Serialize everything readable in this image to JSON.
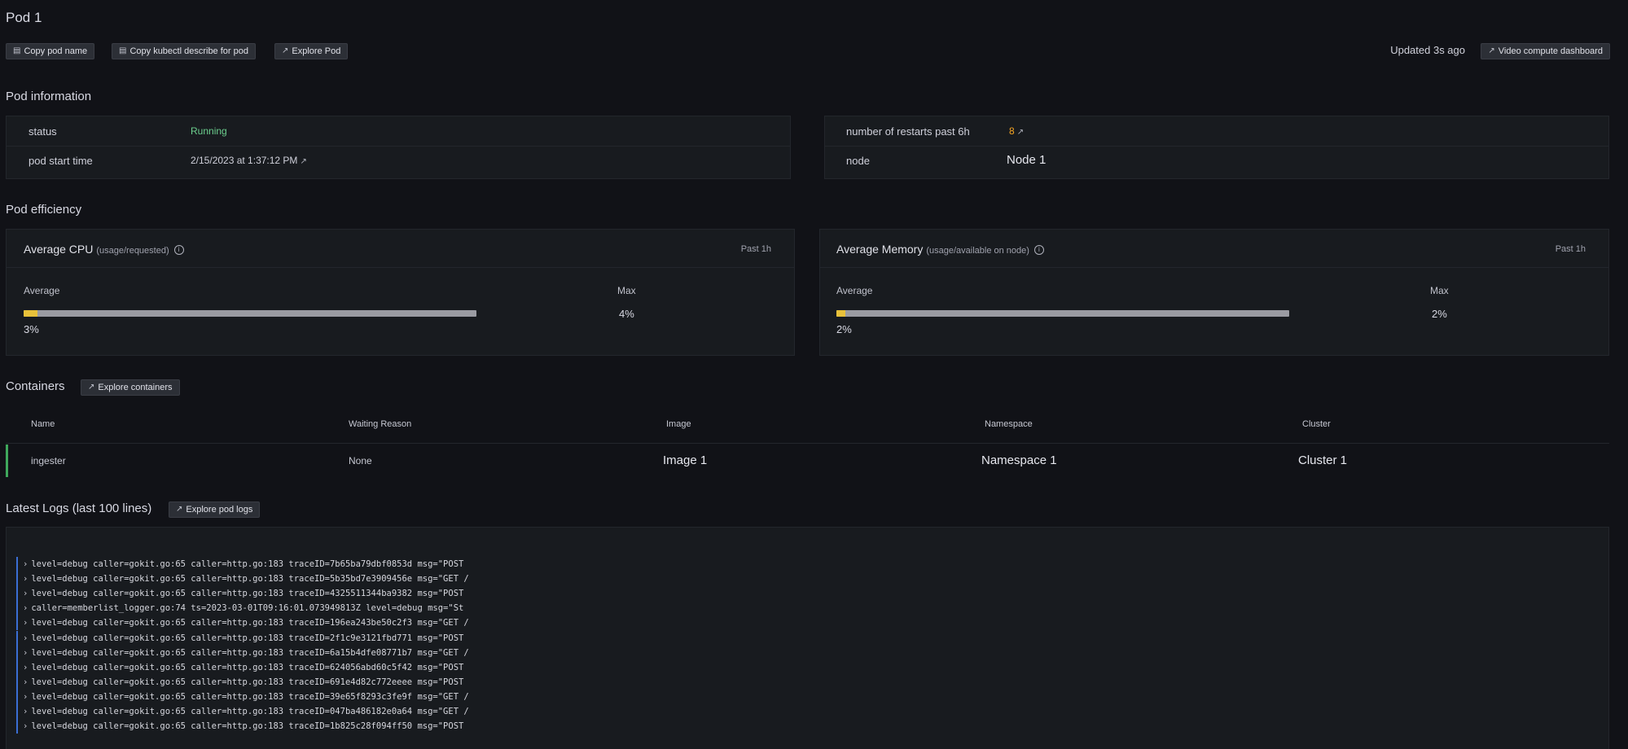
{
  "page": {
    "title": "Pod 1",
    "updated": "Updated 3s ago"
  },
  "toolbar": {
    "copy_pod_name": "Copy pod name",
    "copy_describe": "Copy kubectl describe for pod",
    "explore_pod": "Explore Pod",
    "video_dashboard": "Video compute dashboard"
  },
  "pod_info": {
    "heading": "Pod information",
    "status_label": "status",
    "status_value": "Running",
    "start_label": "pod start time",
    "start_value": "2/15/2023 at 1:37:12 PM",
    "restarts_label": "number of restarts past 6h",
    "restarts_value": "8",
    "node_label": "node",
    "node_value": "Node 1",
    "status_color": "#6ccf8e",
    "restarts_color": "#f5a623"
  },
  "efficiency": {
    "heading": "Pod efficiency",
    "cpu": {
      "title": "Average CPU",
      "subtitle": "(usage/requested)",
      "range": "Past 1h",
      "avg_label": "Average",
      "avg_value": "3%",
      "avg_fraction": 0.03,
      "max_label": "Max",
      "max_value": "4%"
    },
    "memory": {
      "title": "Average Memory",
      "subtitle": "(usage/available on node)",
      "range": "Past 1h",
      "avg_label": "Average",
      "avg_value": "2%",
      "avg_fraction": 0.02,
      "max_label": "Max",
      "max_value": "2%"
    }
  },
  "containers": {
    "heading": "Containers",
    "explore_label": "Explore containers",
    "columns": [
      "Name",
      "Waiting Reason",
      "Image",
      "Namespace",
      "Cluster"
    ],
    "rows": [
      [
        "ingester",
        "None",
        "Image 1",
        "Namespace 1",
        "Cluster 1"
      ]
    ]
  },
  "logs": {
    "heading": "Latest Logs (last 100 lines)",
    "explore_label": "Explore pod logs",
    "lines": [
      "level=debug caller=gokit.go:65 caller=http.go:183 traceID=7b65ba79dbf0853d msg=\"POST",
      "level=debug caller=gokit.go:65 caller=http.go:183 traceID=5b35bd7e3909456e msg=\"GET /",
      "level=debug caller=gokit.go:65 caller=http.go:183 traceID=4325511344ba9382 msg=\"POST",
      "caller=memberlist_logger.go:74 ts=2023-03-01T09:16:01.073949813Z level=debug msg=\"St",
      "level=debug caller=gokit.go:65 caller=http.go:183 traceID=196ea243be50c2f3 msg=\"GET /",
      "level=debug caller=gokit.go:65 caller=http.go:183 traceID=2f1c9e3121fbd771 msg=\"POST",
      "level=debug caller=gokit.go:65 caller=http.go:183 traceID=6a15b4dfe08771b7 msg=\"GET /",
      "level=debug caller=gokit.go:65 caller=http.go:183 traceID=624056abd60c5f42 msg=\"POST",
      "level=debug caller=gokit.go:65 caller=http.go:183 traceID=691e4d82c772eeee msg=\"POST",
      "level=debug caller=gokit.go:65 caller=http.go:183 traceID=39e65f8293c3fe9f msg=\"GET /",
      "level=debug caller=gokit.go:65 caller=http.go:183 traceID=047ba486182e0a64 msg=\"GET /",
      "level=debug caller=gokit.go:65 caller=http.go:183 traceID=1b825c28f094ff50 msg=\"POST"
    ]
  },
  "icons": {
    "copy": "clipboard-icon",
    "external": "external-link-icon",
    "info": "info-icon",
    "chevron": "chevron-right-icon"
  }
}
